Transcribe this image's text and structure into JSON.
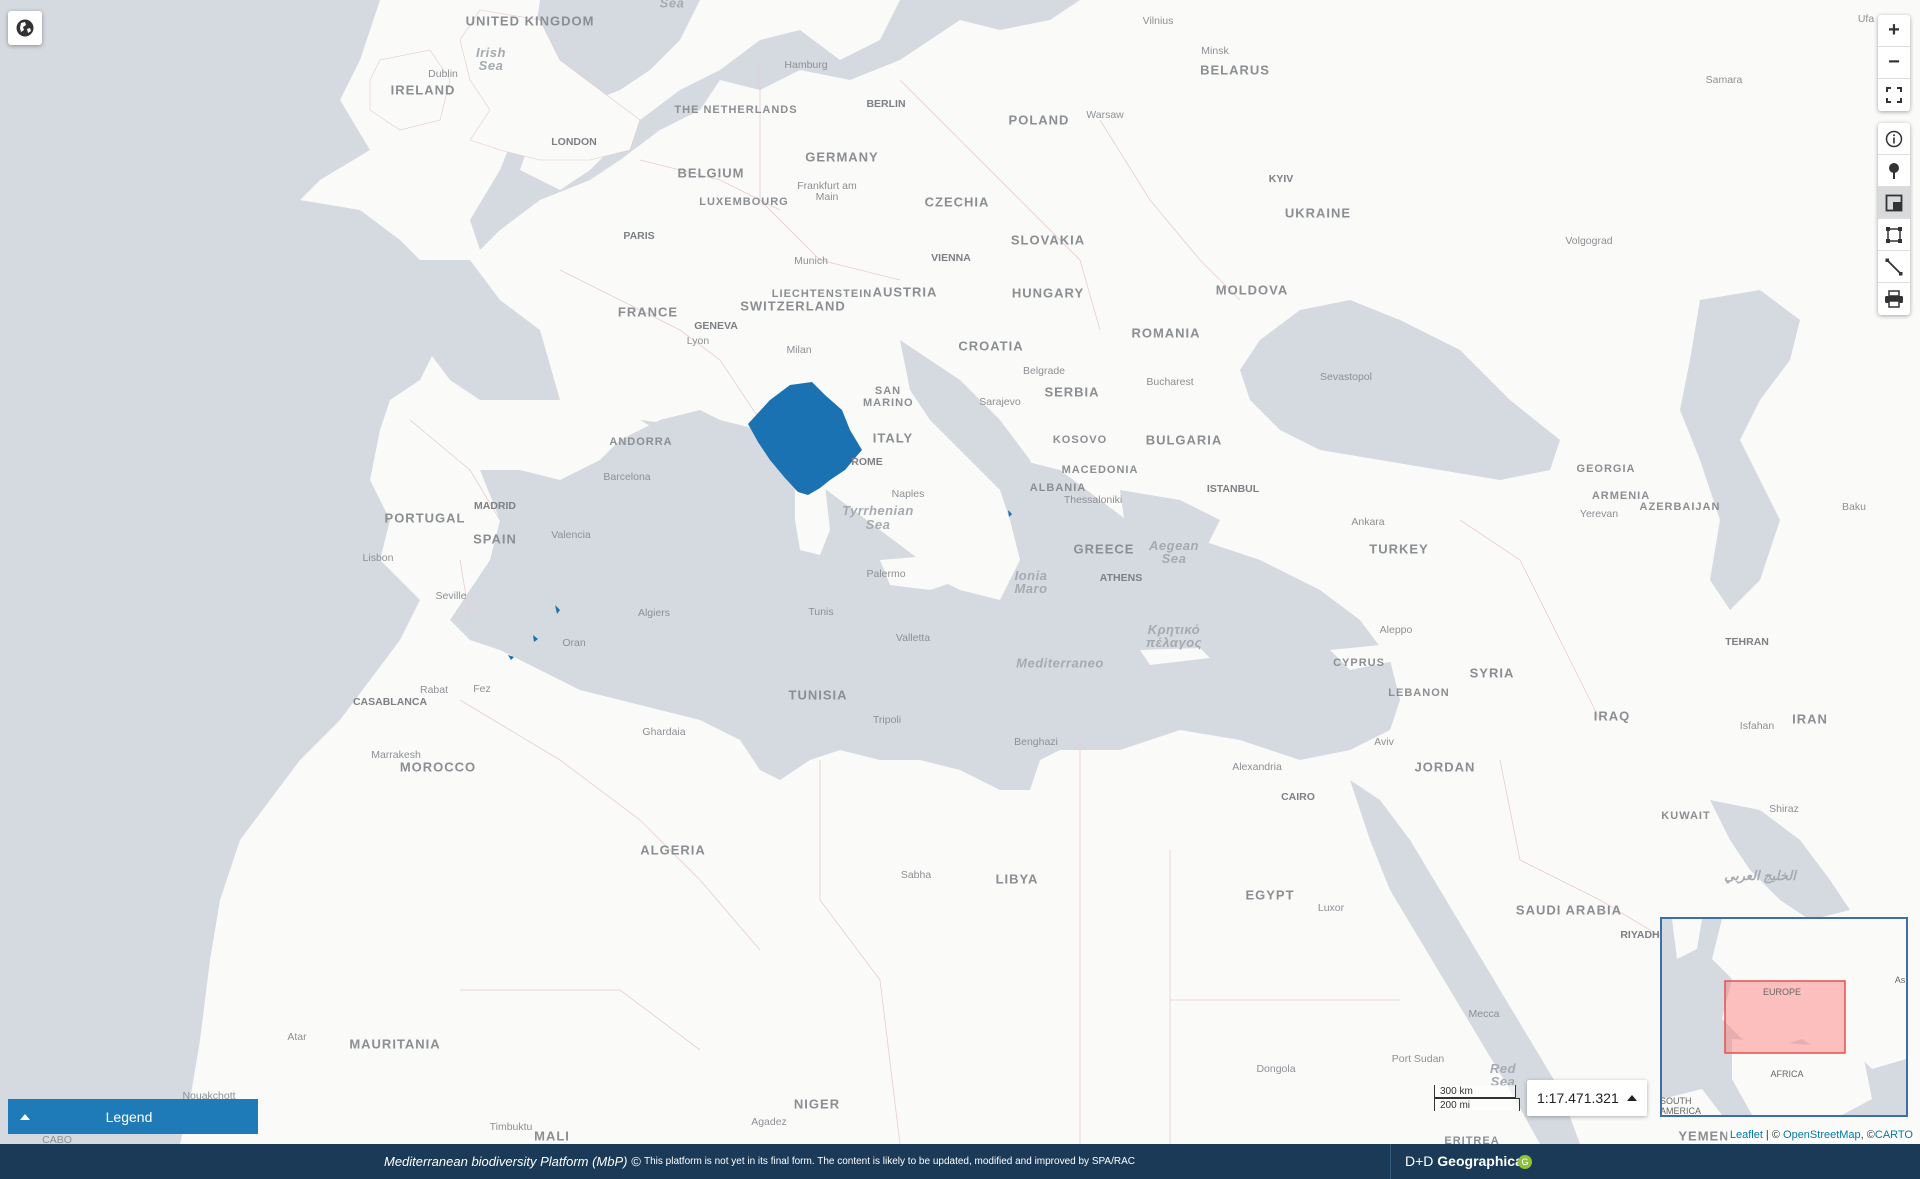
{
  "map": {
    "countries": [
      "UNITED KINGDOM",
      "IRELAND",
      "THE NETHERLANDS",
      "BELGIUM",
      "LUXEMBOURG",
      "GERMANY",
      "POLAND",
      "BELARUS",
      "CZECHIA",
      "SLOVAKIA",
      "UKRAINE",
      "FRANCE",
      "SWITZERLAND",
      "LIECHTENSTEIN",
      "AUSTRIA",
      "HUNGARY",
      "MOLDOVA",
      "ROMANIA",
      "CROATIA",
      "SERBIA",
      "SAN MARINO",
      "ITALY",
      "ANDORRA",
      "PORTUGAL",
      "SPAIN",
      "KOSOVO",
      "BULGARIA",
      "MACEDONIA",
      "ALBANIA",
      "GREECE",
      "TURKEY",
      "GEORGIA",
      "ARMENIA",
      "AZERBAIJAN",
      "CYPRUS",
      "SYRIA",
      "LEBANON",
      "IRAQ",
      "IRAN",
      "JORDAN",
      "KUWAIT",
      "SAUDI ARABIA",
      "TUNISIA",
      "MOROCCO",
      "ALGERIA",
      "LIBYA",
      "EGYPT",
      "MAURITANIA",
      "NIGER",
      "MALI",
      "YEMEN",
      "ERITREA"
    ],
    "cities": [
      "Vilnius",
      "Minsk",
      "Hamburg",
      "BERLIN",
      "Warsaw",
      "Samara",
      "Dublin",
      "LONDON",
      "Frankfurt am Main",
      "KYIV",
      "PARIS",
      "Munich",
      "VIENNA",
      "Volgograd",
      "GENEVA",
      "Lyon",
      "Milan",
      "Belgrade",
      "Bucharest",
      "Sarajevo",
      "Sevastopol",
      "ROME",
      "Barcelona",
      "MADRID",
      "Valencia",
      "Naples",
      "Thessaloniki",
      "ISTANBUL",
      "Baku",
      "Yerevan",
      "Ankara",
      "Lisbon",
      "Palermo",
      "ATHENS",
      "Seville",
      "Algiers",
      "Tunis",
      "Valletta",
      "Aleppo",
      "TEHRAN",
      "Oran",
      "Rabat",
      "Fez",
      "CASABLANCA",
      "Tripoli",
      "Marrakesh",
      "Ghardaia",
      "Benghazi",
      "Alexandria",
      "CAIRO",
      "Aviv",
      "Isfahan",
      "Shiraz",
      "Sabha",
      "Luxor",
      "RIYADH",
      "Mecca",
      "Port Sudan",
      "Dongola",
      "Atar",
      "Nouakchott",
      "Timbuktu",
      "Agadez",
      "Ufa",
      "CABO"
    ],
    "seas": [
      "Sea",
      "Irish Sea",
      "Tyrrhenian Sea",
      "Ionia Maro",
      "Aegean Sea",
      "Κρητικό πέλαγος",
      "Mediterraneo",
      "Red Sea",
      "الخليج العربي"
    ],
    "highlight_color": "#1a72b3"
  },
  "controls": {
    "zoom_in": "+",
    "zoom_out": "−",
    "tools": [
      "fullscreen-icon",
      "info-icon",
      "marker-icon",
      "layer-toggle-icon",
      "rectangle-icon",
      "measure-line-icon",
      "print-icon"
    ]
  },
  "legend": {
    "label": "Legend"
  },
  "scale": {
    "km": "300 km",
    "mi": "200 mi",
    "ratio": "1:17.471.321"
  },
  "minimap": {
    "labels": [
      "EUROPE",
      "AFRICA",
      "SOUTH AMERICA",
      "As"
    ]
  },
  "attribution": {
    "leaflet": "Leaflet",
    "sep": " | © ",
    "osm": "OpenStreetMap",
    "carto_prefix": ", ©",
    "carto": "CARTO"
  },
  "footer": {
    "title": "Mediterranean biodiversity Platform (MbP) ©",
    "note": "This platform is not yet in its final form. The content is likely to be updated, modified and improved by SPA/RAC",
    "brand_prefix": "D+D ",
    "brand_name": "Geographica",
    "badge": "G"
  }
}
